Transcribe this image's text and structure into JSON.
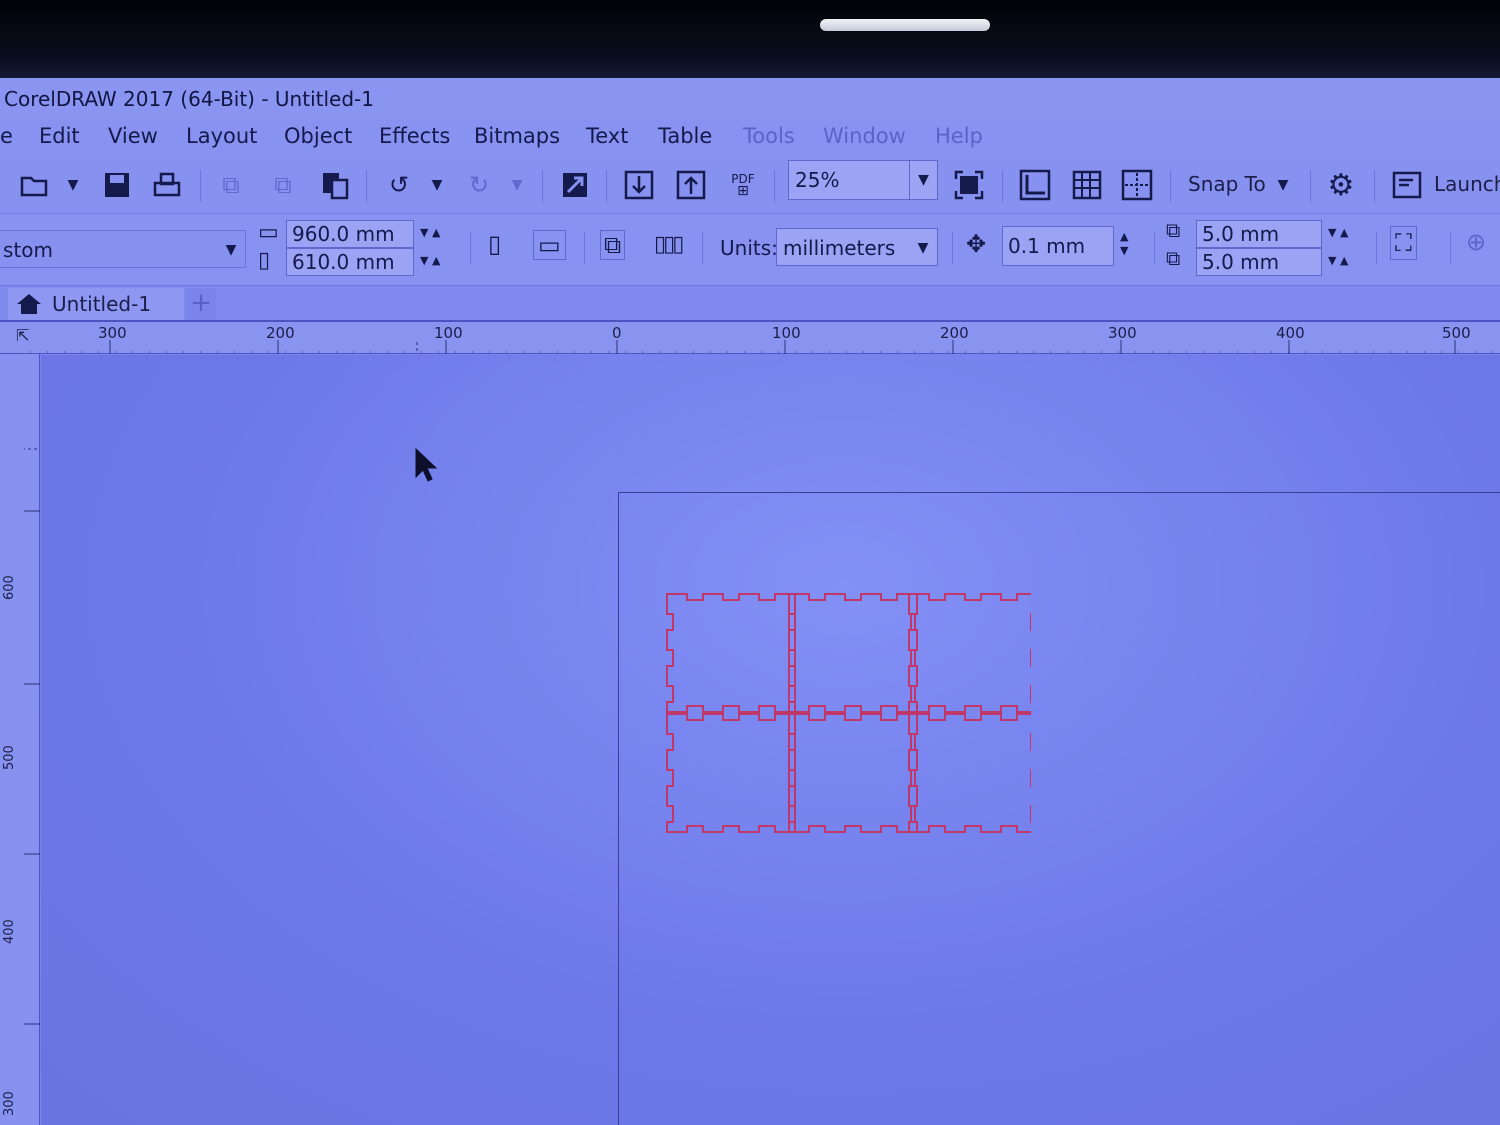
{
  "window": {
    "title": "CorelDRAW 2017 (64-Bit) - Untitled-1"
  },
  "menu": {
    "items": [
      {
        "label": "e"
      },
      {
        "label": "Edit"
      },
      {
        "label": "View"
      },
      {
        "label": "Layout"
      },
      {
        "label": "Object"
      },
      {
        "label": "Effects"
      },
      {
        "label": "Bitmaps"
      },
      {
        "label": "Text"
      },
      {
        "label": "Table"
      },
      {
        "label": "Tools"
      },
      {
        "label": "Window"
      },
      {
        "label": "Help"
      }
    ]
  },
  "toolbar": {
    "zoom": "25%",
    "pdf_label": "PDF",
    "snap_to": "Snap To",
    "launch": "Launch"
  },
  "properties": {
    "page_preset": "stom",
    "width": "960.0 mm",
    "height": "610.0 mm",
    "units_label": "Units:",
    "units_value": "millimeters",
    "nudge": "0.1 mm",
    "dup_x": "5.0 mm",
    "dup_y": "5.0 mm"
  },
  "tabs": {
    "document": "Untitled-1"
  },
  "ruler": {
    "horizontal": [
      "300",
      "200",
      "100",
      "0",
      "100",
      "200",
      "300",
      "400",
      "500"
    ],
    "vertical": [
      "600",
      "500",
      "400",
      "300"
    ]
  },
  "colors": {
    "shape_outline": "#c0386a",
    "screen_tint": "#7a84ec"
  }
}
